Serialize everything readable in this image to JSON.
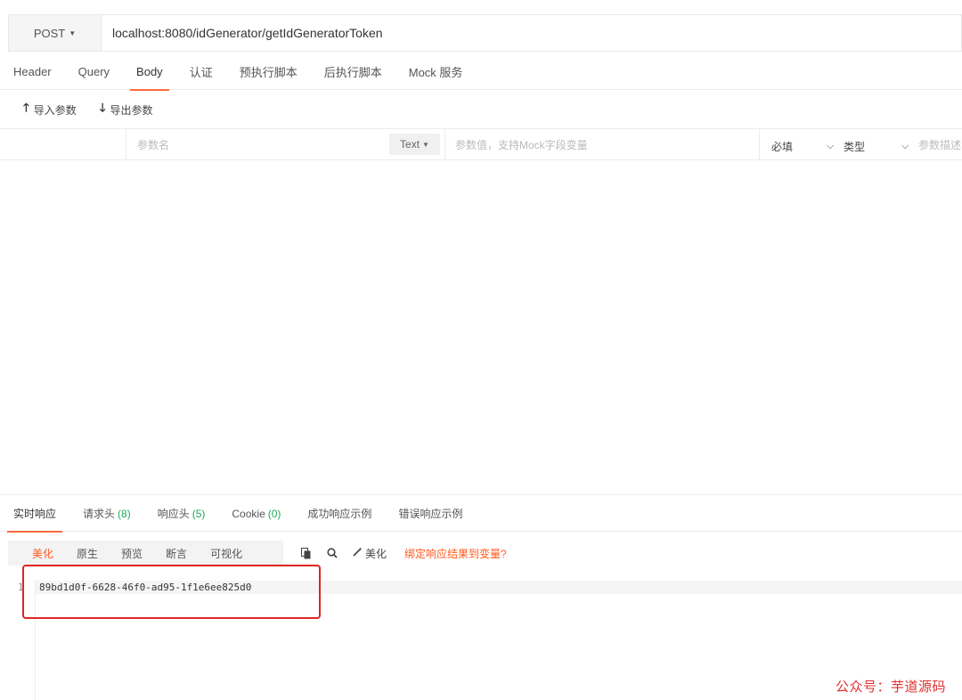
{
  "request": {
    "method": "POST",
    "url": "localhost:8080/idGenerator/getIdGeneratorToken"
  },
  "request_tabs": [
    {
      "label": "Header"
    },
    {
      "label": "Query"
    },
    {
      "label": "Body"
    },
    {
      "label": "认证"
    },
    {
      "label": "预执行脚本"
    },
    {
      "label": "后执行脚本"
    },
    {
      "label": "Mock 服务"
    }
  ],
  "active_request_tab": "Body",
  "io_toolbar": {
    "import_label": "导入参数",
    "export_label": "导出参数"
  },
  "param_row": {
    "name_placeholder": "参数名",
    "type_value": "Text",
    "value_placeholder": "参数值，支持Mock字段变量",
    "required_label": "必填",
    "kind_label": "类型",
    "desc_placeholder": "参数描述"
  },
  "response_tabs": [
    {
      "label": "实时响应",
      "count": ""
    },
    {
      "label": "请求头",
      "count": "(8)"
    },
    {
      "label": "响应头",
      "count": "(5)"
    },
    {
      "label": "Cookie",
      "count": "(0)"
    },
    {
      "label": "成功响应示例",
      "count": ""
    },
    {
      "label": "错误响应示例",
      "count": ""
    }
  ],
  "view_modes": [
    {
      "label": "美化"
    },
    {
      "label": "原生"
    },
    {
      "label": "预览"
    },
    {
      "label": "断言"
    },
    {
      "label": "可视化"
    }
  ],
  "toolbar": {
    "beautify_label": "美化",
    "bind_link": "绑定响应结果到变量?"
  },
  "response_body": {
    "line_number": "1",
    "text": "89bd1d0f-6628-46f0-ad95-1f1e6ee825d0"
  },
  "watermark": "公众号：芋道源码",
  "colors": {
    "accent": "#ff5a1f",
    "count_green": "#21a75b",
    "highlight_box": "#e02424"
  }
}
